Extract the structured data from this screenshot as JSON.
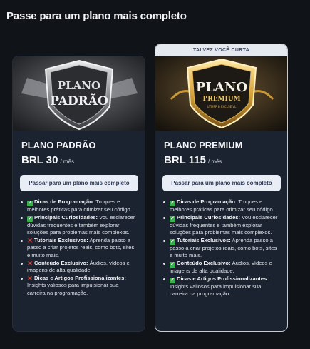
{
  "page": {
    "heading": "Passe para um plano mais completo"
  },
  "plans": [
    {
      "art_text": [
        "PLANO",
        "PADRÃO"
      ],
      "name": "PLANO PADRÃO",
      "price": "BRL 30",
      "period": "/ mês",
      "cta": "Passar para um plano mais completo",
      "features": [
        {
          "included": true,
          "title": "Dicas de Programação:",
          "desc": " Truques e melhores práticas para otimizar seu código."
        },
        {
          "included": true,
          "title": "Principais Curiosidades:",
          "desc": " Vou esclarecer dúvidas frequentes e também explorar soluções para problemas mais complexos."
        },
        {
          "included": false,
          "title": "Tutoriais Exclusivos:",
          "desc": " Aprenda passo a passo a criar projetos reais, como bots, sites e muito mais."
        },
        {
          "included": false,
          "title": "Conteúdo Exclusivo:",
          "desc": " Áudios, vídeos e imagens de alta qualidade."
        },
        {
          "included": false,
          "title": "Dicas e Artigos Profissionalizantes:",
          "desc": " Insights valiosos para impulsionar sua carreira na programação."
        }
      ]
    },
    {
      "badge": "TALVEZ VOCÊ CURTA",
      "art_text": [
        "PLANO",
        "PREMIUM",
        "UTMPP & EXCLSE VL"
      ],
      "name": "PLANO PREMIUM",
      "price": "BRL 115",
      "period": "/ mês",
      "cta": "Passar para um plano mais completo",
      "features": [
        {
          "included": true,
          "title": "Dicas de Programação:",
          "desc": " Truques e melhores práticas para otimizar seu código."
        },
        {
          "included": true,
          "title": "Principais Curiosidades:",
          "desc": " Vou esclarecer dúvidas frequentes e também explorar soluções para problemas mais complexos."
        },
        {
          "included": true,
          "title": "Tutoriais Exclusivos:",
          "desc": " Aprenda passo a passo a criar projetos reais, como bots, sites e muito mais."
        },
        {
          "included": true,
          "title": "Conteúdo Exclusivo:",
          "desc": " Áudios, vídeos e imagens de alta qualidade."
        },
        {
          "included": true,
          "title": "Dicas e Artigos Profissionalizantes:",
          "desc": " Insights valiosos para impulsionar sua carreira na programação."
        }
      ]
    }
  ],
  "colors": {
    "background": "#101318",
    "card": "#1b2230",
    "check": "#36b24a",
    "cross": "#e0473a",
    "button": "#e9edf6",
    "gold": "#d9a43a"
  },
  "icons": {
    "included": "check-mark-icon",
    "excluded": "cross-mark-icon"
  }
}
